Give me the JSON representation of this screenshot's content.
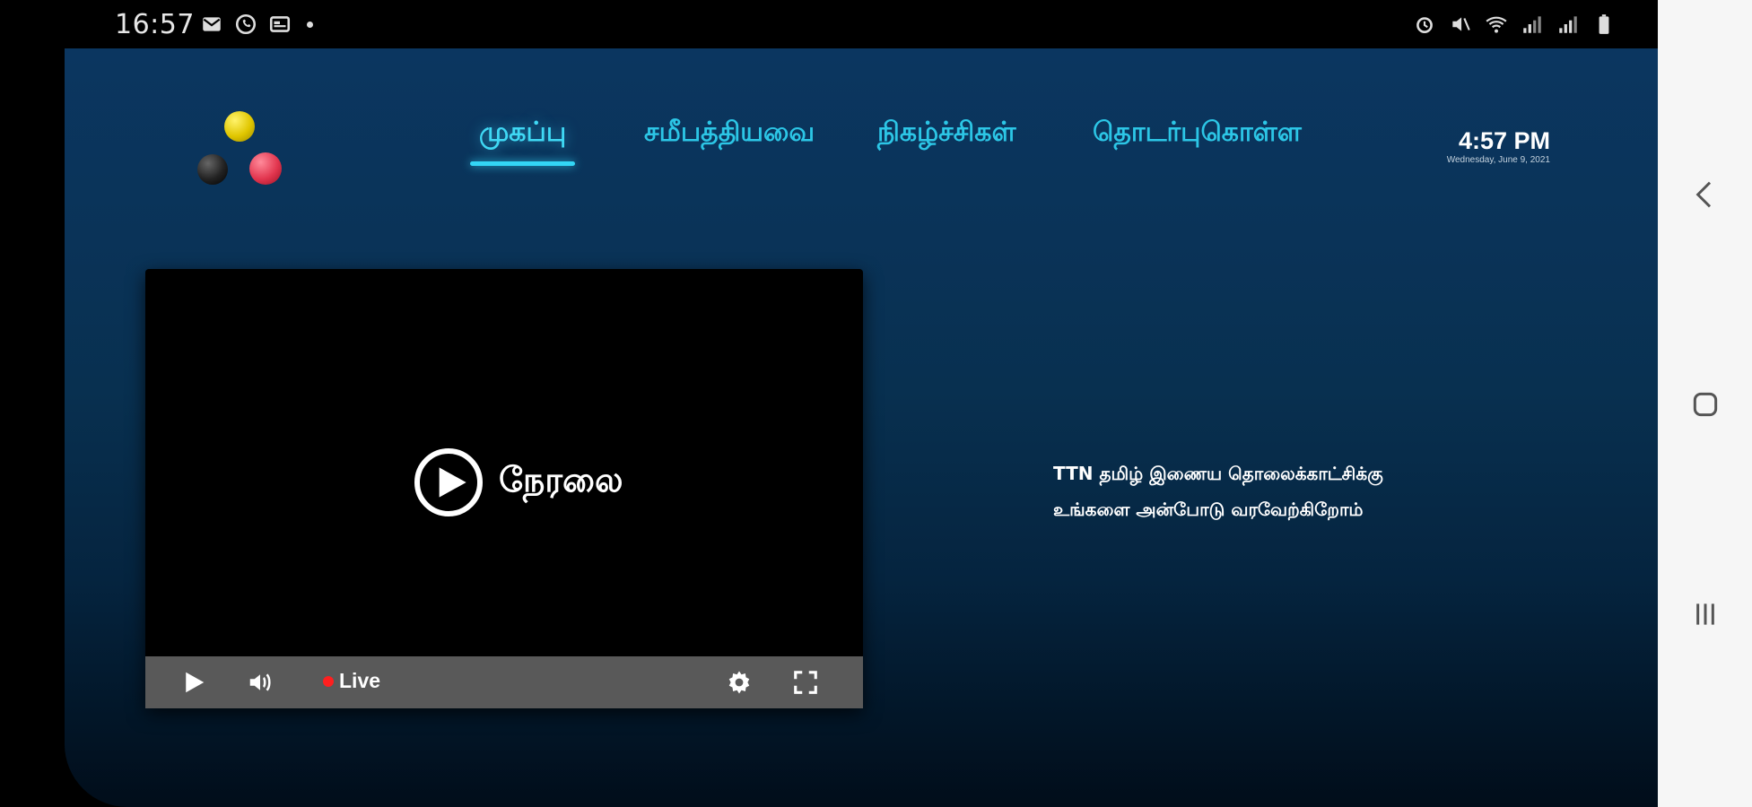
{
  "status_bar": {
    "time": "16:57",
    "left_icons": [
      "mail-icon",
      "whatsapp-icon",
      "news-icon"
    ],
    "right_icons": [
      "alarm-icon",
      "mute-icon",
      "wifi-icon",
      "signal-icon",
      "signal-icon",
      "battery-icon"
    ]
  },
  "app": {
    "logo": "three-balls-logo",
    "nav": {
      "items": [
        {
          "label": "முகப்பு",
          "active": true
        },
        {
          "label": "சமீபத்தியவை",
          "active": false
        },
        {
          "label": "நிகழ்ச்சிகள்",
          "active": false
        },
        {
          "label": "தொடர்புகொள்ள",
          "active": false
        }
      ]
    },
    "clock": {
      "time": "4:57 PM",
      "date": "Wednesday, June 9, 2021"
    },
    "player": {
      "overlay_label": "நேரலை",
      "live_label": "Live",
      "controls": [
        "play-icon",
        "volume-icon",
        "settings-icon",
        "fullscreen-icon"
      ]
    },
    "welcome": {
      "line1": "TTN தமிழ் இணைய தொலைக்காட்சிக்கு",
      "line2": "உங்களை அன்போடு வரவேற்கிறோம்"
    }
  },
  "colors": {
    "accent": "#33d6f5",
    "background_top": "#0b3660",
    "live_dot": "#ff1f1f",
    "controls_bar": "#595959"
  },
  "android_nav": [
    "back-icon",
    "home-icon",
    "recents-icon"
  ]
}
